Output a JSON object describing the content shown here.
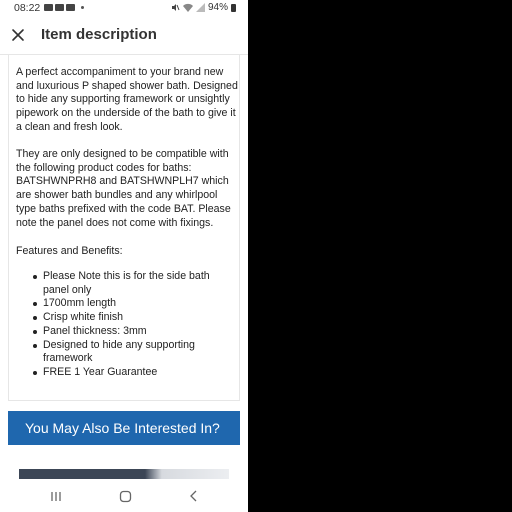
{
  "status_bar": {
    "time": "08:22",
    "battery": "94%",
    "left_icons": [
      "gallery-icon",
      "youtube-icon",
      "youtube-icon",
      "dot-icon"
    ],
    "right_icons": [
      "mute-icon",
      "wifi-icon",
      "signal-icon",
      "battery-icon"
    ]
  },
  "header": {
    "title": "Item description",
    "close_icon": "close-icon"
  },
  "description": {
    "paragraph1": "A perfect accompaniment to your brand new and luxurious P shaped shower bath. Designed to hide any supporting framework or unsightly pipework on the underside of the bath to give it a clean and fresh look.",
    "paragraph2": "They are only designed to be compatible with the following product codes for baths: BATSHWNPRH8 and BATSHWNPLH7 which are shower bath bundles and any whirlpool type baths prefixed with the code BAT. Please note the panel does not come with fixings.",
    "features_heading": "Features and Benefits:",
    "features": [
      "Please Note this is for the side bath panel only",
      "1700mm length",
      "Crisp white finish",
      "Panel thickness: 3mm",
      "Designed to hide any supporting framework",
      "FREE 1 Year Guarantee"
    ]
  },
  "related": {
    "title": "You May Also Be Interested In?"
  },
  "colors": {
    "banner": "#1f67ae",
    "text": "#222222",
    "background": "#ffffff"
  },
  "nav_bar": {
    "icons": [
      "recent-apps-icon",
      "home-icon",
      "back-icon"
    ]
  }
}
